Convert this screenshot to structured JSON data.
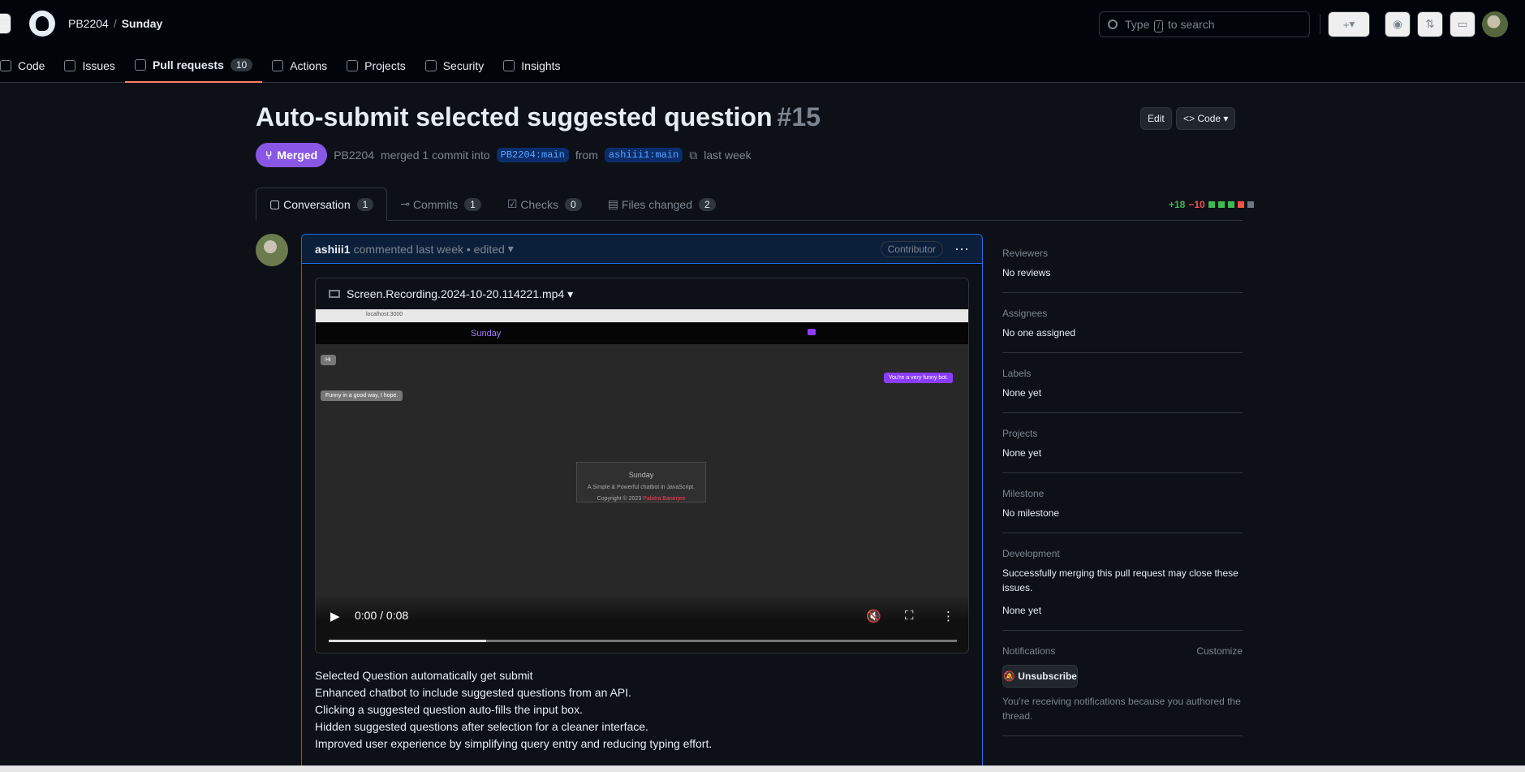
{
  "repository": {
    "owner": "PB2204",
    "separator": "/",
    "name": "Sunday"
  },
  "search": {
    "prefix": "Type",
    "slash_key": "/",
    "suffix": "to search"
  },
  "repo_nav": [
    {
      "label": "Code",
      "icon": "code-icon"
    },
    {
      "label": "Issues",
      "icon": "issue-icon"
    },
    {
      "label": "Pull requests",
      "count": "10",
      "icon": "pull-request-icon"
    },
    {
      "label": "Actions",
      "icon": "play-icon"
    },
    {
      "label": "Projects",
      "icon": "table-icon"
    },
    {
      "label": "Security",
      "icon": "shield-icon"
    },
    {
      "label": "Insights",
      "icon": "graph-icon"
    }
  ],
  "pr": {
    "title": "Auto-submit selected suggested question",
    "number": "#15",
    "status": "Merged",
    "author": "PB2204",
    "action": "merged 1 commit into",
    "base_branch": "PB2204:main",
    "from_label": "from",
    "head_branch": "ashiii1:main",
    "time": "last week",
    "edit_label": "Edit",
    "code_label": "Code"
  },
  "tabs": [
    {
      "label": "Conversation",
      "count": "1"
    },
    {
      "label": "Commits",
      "count": "1"
    },
    {
      "label": "Checks",
      "count": "0"
    },
    {
      "label": "Files changed",
      "count": "2"
    }
  ],
  "diffstat": {
    "additions": "+18",
    "deletions": "−10"
  },
  "comment": {
    "author": "ashiii1",
    "meta": "commented last week • edited",
    "role": "Contributor",
    "video": {
      "filename": "Screen.Recording.2024-10-20.114221.mp4",
      "url": "localhost:3000",
      "app_name": "Sunday",
      "messages": [
        "Hi",
        "You're a very funny bot.",
        "Funny in a good way, I hope."
      ],
      "card_title": "Sunday",
      "card_subtitle": "A Simple & Powerful chatbot in JavaScript.",
      "copyright": "Copyright © 2023",
      "copyright_name": "Pabitra Banerjee",
      "time": "0:00 / 0:08",
      "progress": 0.25
    },
    "body": [
      "Selected Question automatically get submit",
      "Enhanced chatbot to include suggested questions from an API.",
      "Clicking a suggested question auto-fills the input box.",
      "Hidden suggested questions after selection for a cleaner interface.",
      "Improved user experience by simplifying query entry and reducing typing effort."
    ]
  },
  "sidebar": {
    "sections": [
      {
        "label": "Reviewers",
        "value": "No reviews"
      },
      {
        "label": "Assignees",
        "value": "No one assigned"
      },
      {
        "label": "Labels",
        "value": "None yet"
      },
      {
        "label": "Projects",
        "value": "None yet"
      },
      {
        "label": "Milestone",
        "value": "No milestone"
      }
    ],
    "development": {
      "label": "Development",
      "note": "Successfully merging this pull request may close these issues.",
      "value": "None yet"
    },
    "notifications": {
      "label": "Notifications",
      "customize": "Customize",
      "button": "Unsubscribe",
      "note": "You’re receiving notifications because you authored the thread."
    }
  }
}
